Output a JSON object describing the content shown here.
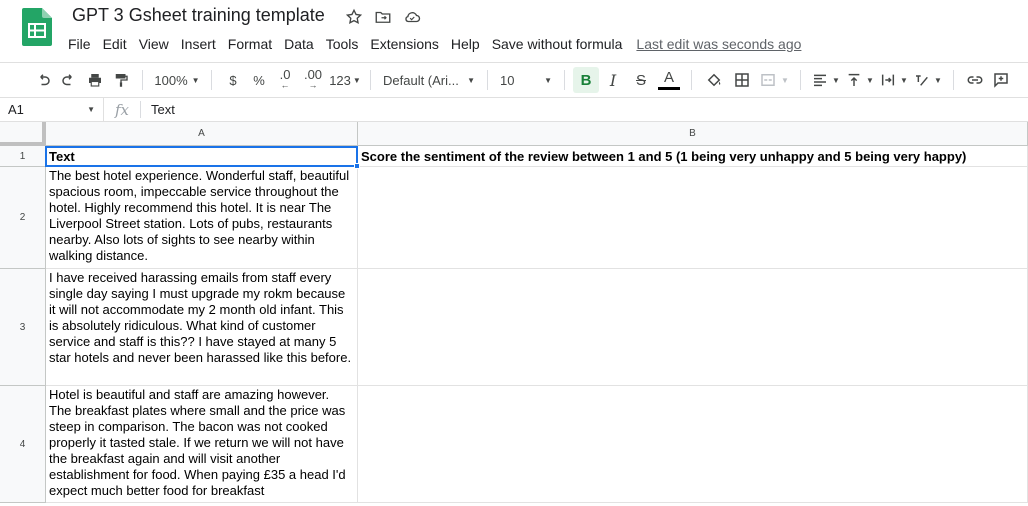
{
  "app": {
    "doc_title": "GPT 3 Gsheet training template",
    "last_edit": "Last edit was seconds ago"
  },
  "menu": [
    "File",
    "Edit",
    "View",
    "Insert",
    "Format",
    "Data",
    "Tools",
    "Extensions",
    "Help",
    "Save without formula"
  ],
  "toolbar": {
    "zoom": "100%",
    "currency": "$",
    "percent": "%",
    "dec_decrease": ".0",
    "dec_increase": ".00",
    "more_formats": "123",
    "font": "Default (Ari...",
    "font_size": "10",
    "bold": "B",
    "italic": "I",
    "strike": "S",
    "text_color": "A"
  },
  "formula_bar": {
    "cell_ref": "A1",
    "fx": "fx",
    "value": "Text"
  },
  "columns": [
    "A",
    "B"
  ],
  "rows": [
    {
      "num": "1",
      "a": "Text",
      "b": "Score the sentiment of the review between 1 and 5 (1 being very unhappy and 5 being very happy)"
    },
    {
      "num": "2",
      "a": "The best hotel experience. Wonderful staff, beautiful spacious room, impeccable service throughout the hotel. Highly recommend this hotel. It is near The Liverpool Street station. Lots of pubs, restaurants nearby. Also lots of sights to see nearby within walking distance.",
      "b": ""
    },
    {
      "num": "3",
      "a": "I have received harassing emails from staff every single day saying I must upgrade my rokm because it will not accommodate my 2 month old infant. This is absolutely ridiculous. What kind of customer service and staff is this?? I have stayed at many 5 star hotels and never been harassed like this before.",
      "b": ""
    },
    {
      "num": "4",
      "a": "Hotel is beautiful and staff are amazing however. The breakfast plates where small and the price was steep in comparison. The bacon was not cooked properly it tasted stale. If we return we will not have the breakfast again and will visit another establishment for food. When paying £35 a head I'd expect much better food for breakfast",
      "b": ""
    }
  ],
  "colors": {
    "sheets_green": "#23a566",
    "selection_blue": "#1a73e8",
    "bold_active_bg": "#e6f4ea"
  }
}
